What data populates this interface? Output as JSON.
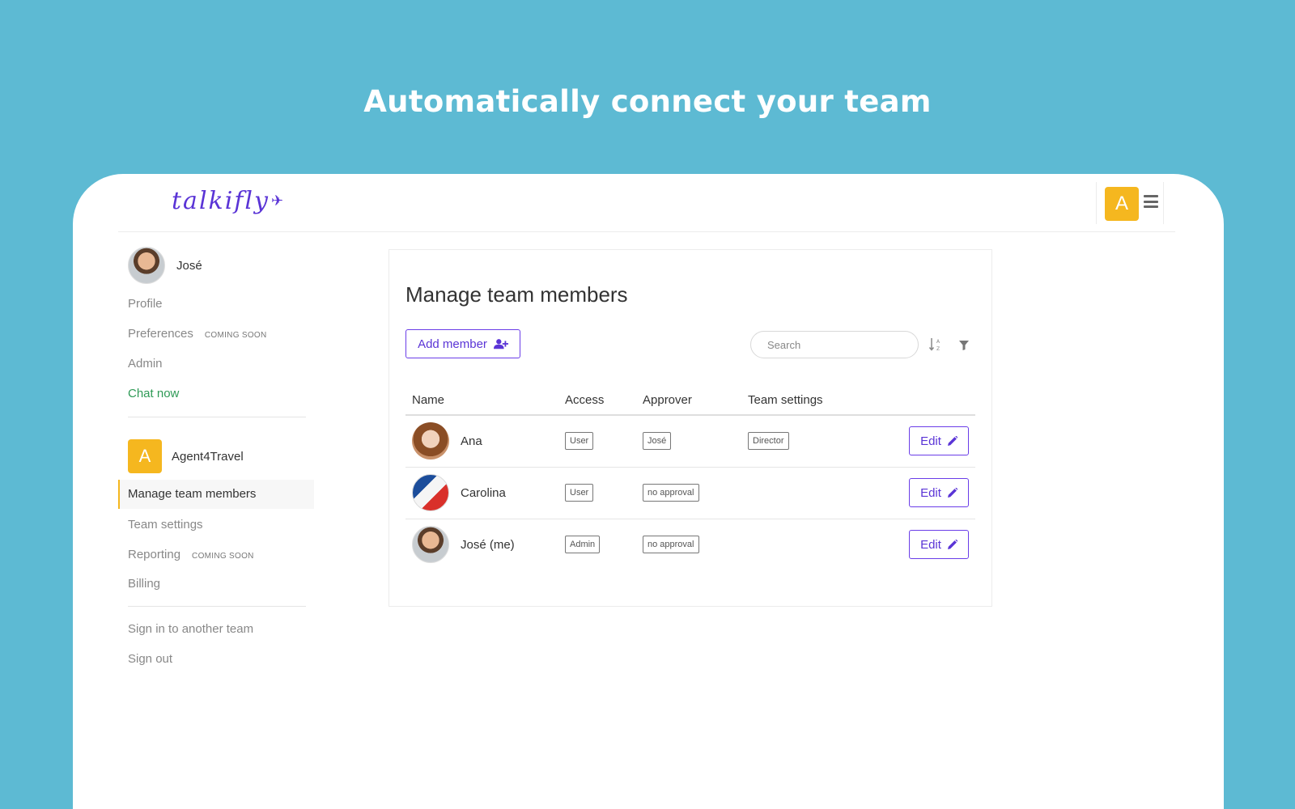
{
  "headline": "Automatically connect your team",
  "app": {
    "logo_text": "talkifly",
    "team_initial": "A"
  },
  "sidebar": {
    "user_name": "José",
    "items": [
      {
        "label": "Profile"
      },
      {
        "label": "Preferences",
        "badge": "COMING SOON"
      },
      {
        "label": "Admin"
      },
      {
        "label": "Chat now"
      }
    ],
    "team": {
      "initial": "A",
      "name": "Agent4Travel"
    },
    "team_items": [
      {
        "label": "Manage team members",
        "active": true
      },
      {
        "label": "Team settings"
      },
      {
        "label": "Reporting",
        "badge": "COMING SOON"
      },
      {
        "label": "Billing"
      }
    ],
    "footer_items": [
      {
        "label": "Sign in to another team"
      },
      {
        "label": "Sign out"
      }
    ]
  },
  "main": {
    "title": "Manage team members",
    "add_button_label": "Add member",
    "search_placeholder": "Search",
    "columns": [
      "Name",
      "Access",
      "Approver",
      "Team settings"
    ],
    "rows": [
      {
        "name": "Ana",
        "access": "User",
        "approver": "José",
        "team_settings": "Director",
        "edit_label": "Edit"
      },
      {
        "name": "Carolina",
        "access": "User",
        "approver": "no approval",
        "team_settings": "",
        "edit_label": "Edit"
      },
      {
        "name": "José (me)",
        "access": "Admin",
        "approver": "no approval",
        "team_settings": "",
        "edit_label": "Edit"
      }
    ]
  },
  "colors": {
    "background": "#5dbad3",
    "accent": "#5a34d6",
    "team_badge": "#f5b71f",
    "chat_link": "#2e9a56"
  },
  "icons": [
    "user-plus-icon",
    "sort-alpha-icon",
    "filter-icon",
    "pencil-icon",
    "menu-icon",
    "plane-icon"
  ]
}
